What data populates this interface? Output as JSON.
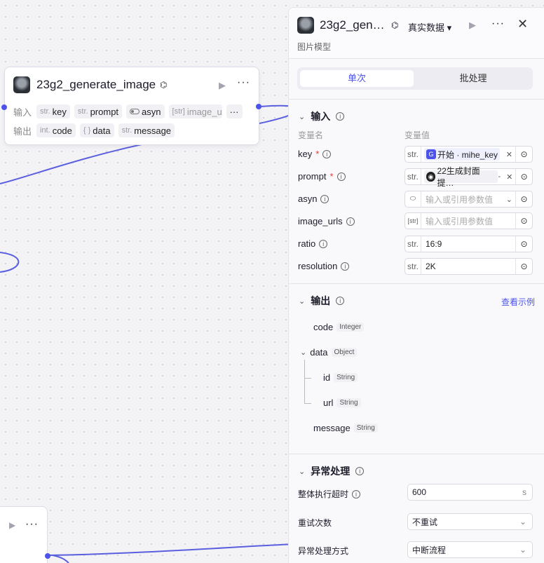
{
  "node": {
    "title": "23g2_generate_image",
    "input_label": "输入",
    "output_label": "输出",
    "inputs": [
      {
        "type": "str.",
        "name": "key"
      },
      {
        "type": "str.",
        "name": "prompt"
      },
      {
        "type": "toggle",
        "name": "asyn"
      },
      {
        "type": "[str]",
        "name": "image_url"
      }
    ],
    "outputs": [
      {
        "type": "int.",
        "name": "code"
      },
      {
        "type": "{ }",
        "name": "data"
      },
      {
        "type": "str.",
        "name": "message"
      }
    ],
    "more_label": "···"
  },
  "panel": {
    "title": "23g2_gen…",
    "data_mode": "真实数据 ▾",
    "subtitle": "图片模型",
    "tabs": {
      "single": "单次",
      "batch": "批处理"
    },
    "input_section": {
      "title": "输入",
      "col_name": "变量名",
      "col_value": "变量值",
      "params": [
        {
          "name": "key",
          "required": true,
          "type": "str.",
          "chip": "开始 · mihe_key",
          "kind": "chip"
        },
        {
          "name": "prompt",
          "required": true,
          "type": "str.",
          "chip": "22生成封面提…",
          "suffix": "-",
          "kind": "chip2"
        },
        {
          "name": "asyn",
          "required": false,
          "type": "toggle",
          "placeholder": "输入或引用参数值",
          "kind": "select"
        },
        {
          "name": "image_urls",
          "required": false,
          "type": "[str]",
          "placeholder": "输入或引用参数值",
          "kind": "ph"
        },
        {
          "name": "ratio",
          "required": false,
          "type": "str.",
          "value": "16:9",
          "kind": "val"
        },
        {
          "name": "resolution",
          "required": false,
          "type": "str.",
          "value": "2K",
          "kind": "val"
        }
      ]
    },
    "output_section": {
      "title": "输出",
      "see_example": "查看示例",
      "fields": [
        {
          "name": "code",
          "type": "Integer"
        },
        {
          "name": "data",
          "type": "Object"
        },
        {
          "name": "id",
          "type": "String"
        },
        {
          "name": "url",
          "type": "String"
        },
        {
          "name": "message",
          "type": "String"
        }
      ]
    },
    "error_section": {
      "title": "异常处理",
      "timeout_label": "整体执行超时",
      "timeout_value": "600",
      "timeout_unit": "s",
      "retry_label": "重试次数",
      "retry_value": "不重试",
      "handling_label": "异常处理方式",
      "handling_value": "中断流程"
    }
  },
  "colors": {
    "accent": "#4d53e8",
    "edge": "#5a5fe0"
  }
}
